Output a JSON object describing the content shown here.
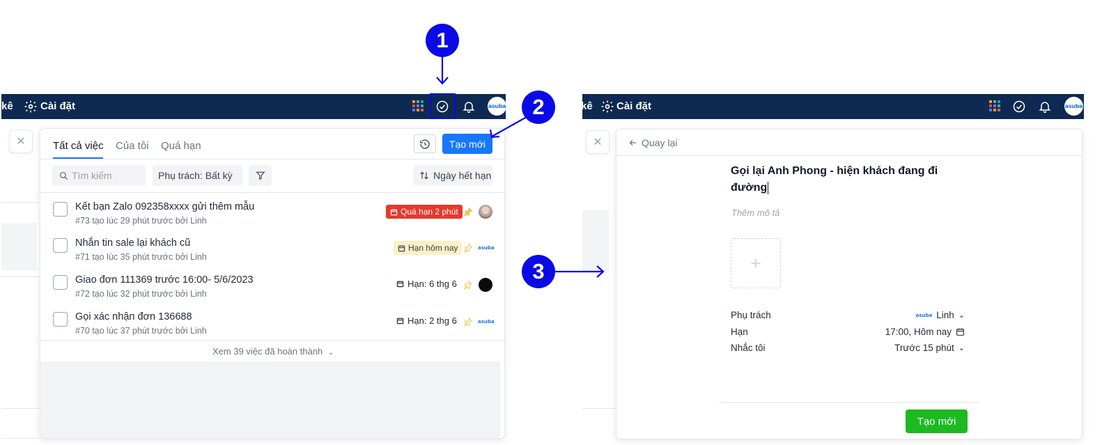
{
  "markers": [
    "1",
    "2",
    "3"
  ],
  "left": {
    "navbar": {
      "partial_label": "kê",
      "settings_label": "Cài đặt",
      "avatar_text": "asuba"
    },
    "tabs": [
      {
        "label": "Tất cả việc",
        "active": true
      },
      {
        "label": "Của tôi",
        "active": false
      },
      {
        "label": "Quá hạn",
        "active": false
      }
    ],
    "create_button": "Tạo mới",
    "search_placeholder": "Tìm kiếm",
    "assignee_filter": "Phụ trách: Bất kỳ",
    "sort_label": "Ngày hết hạn",
    "tasks": [
      {
        "title": "Kết bạn Zalo 092358xxxx gửi thêm mẫu",
        "meta": "#73 tạo lúc 29 phút trước bởi Linh",
        "due": "Quá hạn 2 phút",
        "due_style": "overdue",
        "pinned": true,
        "avatar": "photo"
      },
      {
        "title": "Nhắn tin sale lại khách cũ",
        "meta": "#71 tạo lúc 35 phút trước bởi Linh",
        "due": "Hạn hôm nay",
        "due_style": "today",
        "pinned": false,
        "avatar": "asuba"
      },
      {
        "title": "Giao đơn 111369 trước 16:00- 5/6/2023",
        "meta": "#72 tạo lúc 32 phút trước bởi Linh",
        "due": "Hạn: 6 thg 6",
        "due_style": "normal",
        "pinned": false,
        "avatar": "dark"
      },
      {
        "title": "Gọi xác nhận đơn 136688",
        "meta": "#70 tạo lúc 37 phút trước bởi Linh",
        "due": "Hạn: 2 thg 6",
        "due_style": "normal",
        "pinned": false,
        "avatar": "asuba"
      }
    ],
    "completed_link": "Xem 39 việc đã hoàn thành"
  },
  "right": {
    "navbar": {
      "partial_label": "kê",
      "settings_label": "Cài đặt",
      "avatar_text": "asuba"
    },
    "back_label": "Quay lại",
    "task_title_line1": "Gọi lại Anh Phong - hiện khách đang đi",
    "task_title_line2": "đường",
    "description_placeholder": "Thêm mô tả",
    "fields": [
      {
        "label": "Phụ trách",
        "value": "Linh"
      },
      {
        "label": "Hạn",
        "value": "17:00, Hôm nay"
      },
      {
        "label": "Nhắc tôi",
        "value": "Trước 15 phút"
      }
    ],
    "assignee_logo": "asuba",
    "create_button": "Tạo mới"
  },
  "colors": {
    "navbar": "#0f2a52",
    "primary": "#1677ff",
    "marker": "#0a0ae6",
    "overdue": "#e5392e",
    "today_bg": "#fdf0c4",
    "create_green": "#1db920"
  }
}
